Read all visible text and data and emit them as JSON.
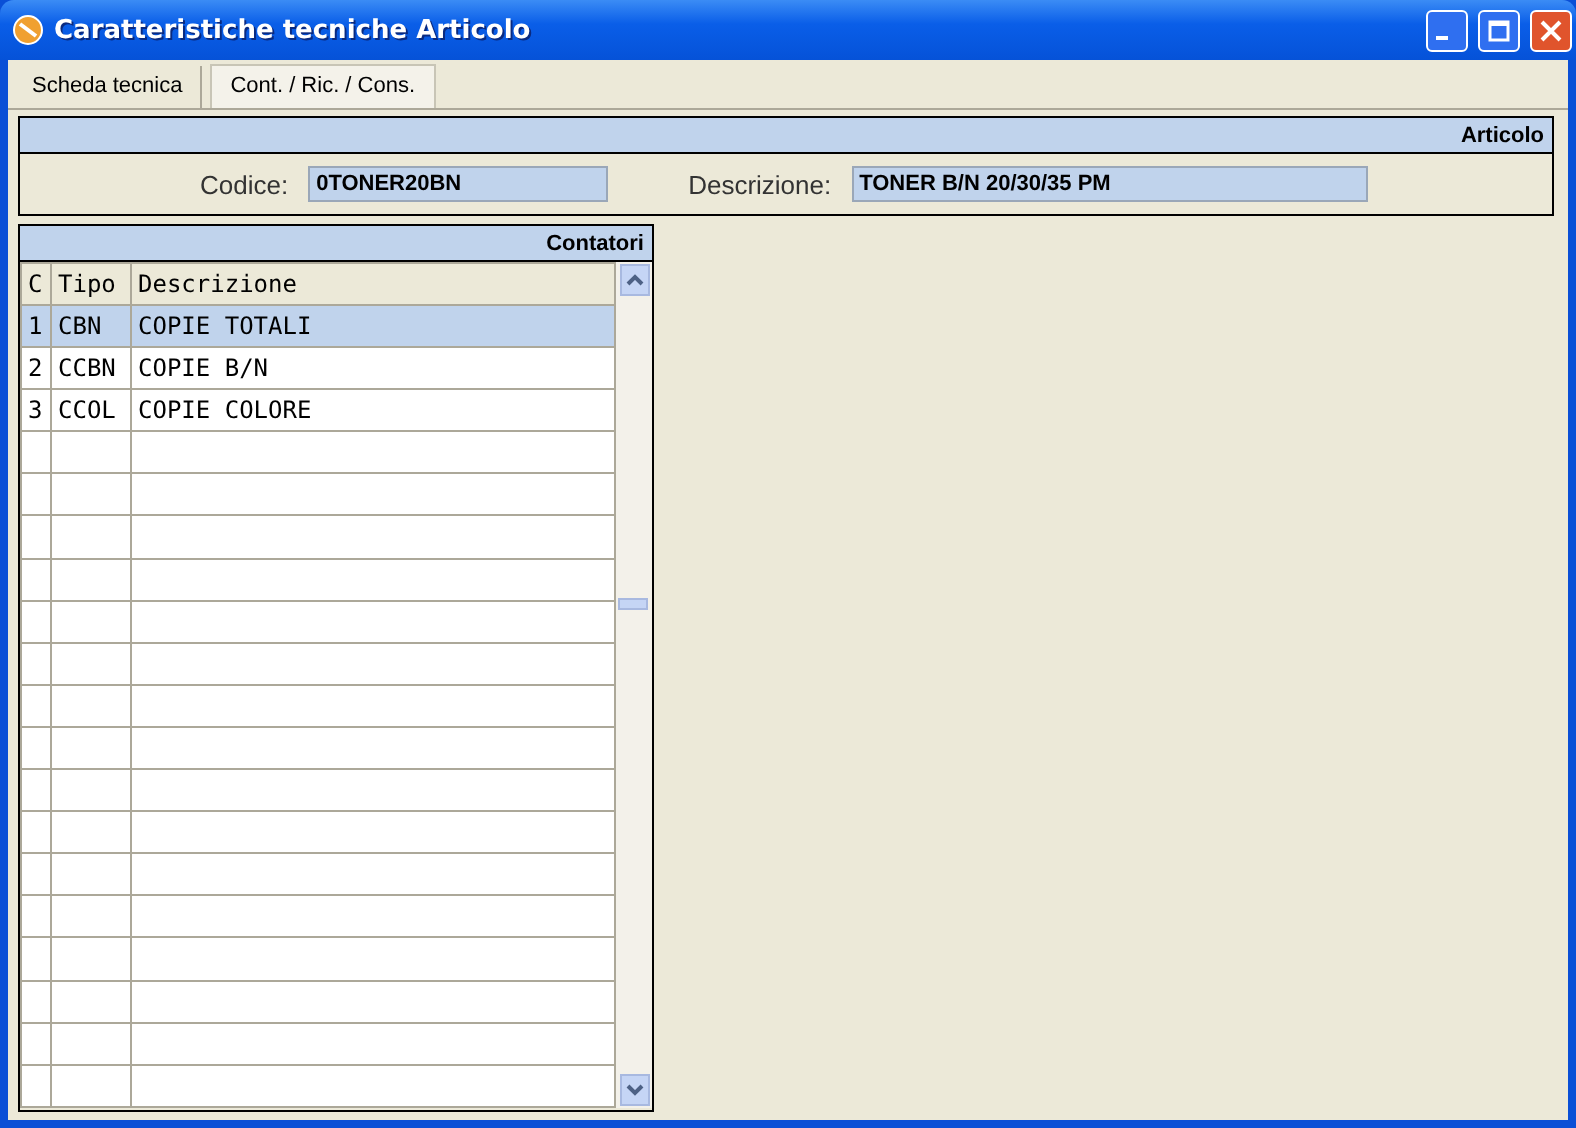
{
  "window": {
    "title": "Caratteristiche tecniche Articolo"
  },
  "tabs": [
    {
      "label": "Scheda tecnica",
      "selected": false
    },
    {
      "label": "Cont. / Ric. / Cons.",
      "selected": true
    }
  ],
  "article_panel": {
    "title": "Articolo",
    "fields": [
      {
        "label": "Codice:",
        "value": "0TONER20BN"
      },
      {
        "label": "Descrizione:",
        "value": "TONER B/N 20/30/35 PM"
      }
    ]
  },
  "counters_panel": {
    "title": "Contatori",
    "columns": [
      "C",
      "Tipo",
      "Descrizione"
    ],
    "rows": [
      {
        "cells": [
          "1",
          "CBN",
          "COPIE TOTALI"
        ],
        "selected": true
      },
      {
        "cells": [
          "2",
          "CCBN",
          "COPIE B/N"
        ],
        "selected": false
      },
      {
        "cells": [
          "3",
          "CCOL",
          "COPIE COLORE"
        ],
        "selected": false
      }
    ]
  }
}
